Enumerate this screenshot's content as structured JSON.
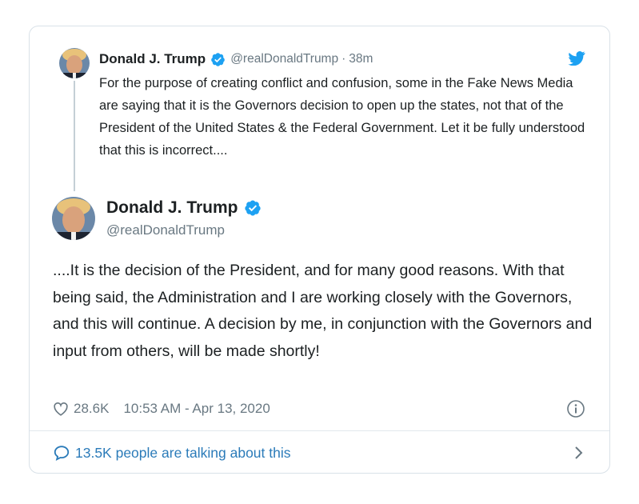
{
  "parent_tweet": {
    "name": "Donald J. Trump",
    "handle": "@realDonaldTrump",
    "separator": "·",
    "time": "38m",
    "text": "For the purpose of creating conflict and confusion, some in the Fake News Media are saying that it is the Governors decision to open up the states, not that of the President of the United States & the Federal Government. Let it be fully understood that this is incorrect....",
    "avatar_icon": "profile-photo",
    "verified_icon": "verified-badge-icon",
    "brand_icon": "twitter-bird-icon"
  },
  "main_tweet": {
    "name": "Donald J. Trump",
    "handle": "@realDonaldTrump",
    "text": "....It is the decision of the President, and for many good reasons. With that being said, the Administration and I are working closely with the Governors, and this will continue. A decision by me, in conjunction with the Governors and input from others, will be made shortly!",
    "likes": "28.6K",
    "timestamp": "10:53 AM - Apr 13, 2020",
    "heart_icon": "heart-icon",
    "info_icon": "info-icon"
  },
  "footer": {
    "talking_text": "13.5K people are talking about this",
    "bubble_icon": "speech-bubble-icon",
    "chevron_icon": "chevron-right-icon"
  },
  "colors": {
    "verified": "#1da1f2",
    "link": "#2b7bb9",
    "muted": "#697882",
    "text": "#1c2022",
    "border": "#d9e1e8"
  }
}
